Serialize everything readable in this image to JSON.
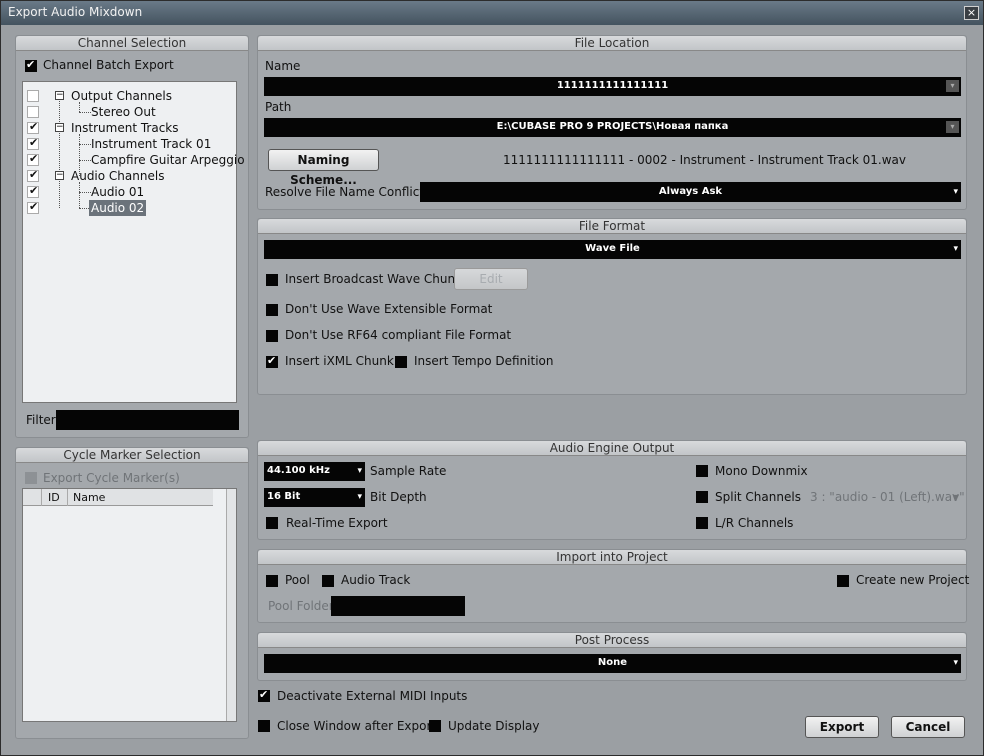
{
  "window": {
    "title": "Export Audio Mixdown",
    "close": "×"
  },
  "channel_selection": {
    "header": "Channel Selection",
    "batch_export": {
      "label": "Channel Batch Export",
      "checked": true
    },
    "tree": [
      {
        "label": "Output Channels",
        "checked": false,
        "level": 0
      },
      {
        "label": "Stereo Out",
        "checked": false,
        "level": 1
      },
      {
        "label": "Instrument Tracks",
        "checked": true,
        "level": 0
      },
      {
        "label": "Instrument Track 01",
        "checked": true,
        "level": 1
      },
      {
        "label": "Campfire Guitar Arpeggio",
        "checked": true,
        "level": 1
      },
      {
        "label": "Audio Channels",
        "checked": true,
        "level": 0
      },
      {
        "label": "Audio 01",
        "checked": true,
        "level": 1
      },
      {
        "label": "Audio 02",
        "checked": true,
        "level": 1,
        "selected": true
      }
    ],
    "filter_label": "Filter",
    "filter_value": ""
  },
  "cycle_marker": {
    "header": "Cycle Marker Selection",
    "export_label": "Export Cycle Marker(s)",
    "columns": [
      "ID",
      "Name"
    ]
  },
  "file_location": {
    "header": "File Location",
    "name_label": "Name",
    "name_value": "1111111111111111",
    "path_label": "Path",
    "path_value": "E:\\CUBASE PRO 9 PROJECTS\\Новая папка",
    "naming_button": "Naming Scheme...",
    "file_preview": "1111111111111111 - 0002 - Instrument - Instrument Track 01.wav",
    "resolve_label": "Resolve File Name Conflicts",
    "resolve_value": "Always Ask"
  },
  "file_format": {
    "header": "File Format",
    "format_value": "Wave File",
    "broadcast_label": "Insert Broadcast Wave Chunk",
    "edit_button": "Edit",
    "wave_ext_label": "Don't Use Wave Extensible Format",
    "rf64_label": "Don't Use RF64 compliant File Format",
    "ixml_label": "Insert iXML Chunk",
    "tempo_label": "Insert Tempo Definition"
  },
  "audio_engine": {
    "header": "Audio Engine Output",
    "sample_rate_value": "44.100 kHz",
    "sample_rate_label": "Sample Rate",
    "bit_depth_value": "16 Bit",
    "bit_depth_label": "Bit Depth",
    "realtime_label": "Real-Time Export",
    "mono_label": "Mono Downmix",
    "split_label": "Split Channels",
    "split_value": "3 : \"audio - 01 (Left).wav\"",
    "lr_label": "L/R Channels"
  },
  "import_project": {
    "header": "Import into Project",
    "pool_label": "Pool",
    "audio_track_label": "Audio Track",
    "new_project_label": "Create new Project",
    "pool_folder_label": "Pool Folder"
  },
  "post_process": {
    "header": "Post Process",
    "value": "None"
  },
  "footer": {
    "deactivate_midi": "Deactivate External MIDI Inputs",
    "close_after": "Close Window after Export",
    "update_display": "Update Display",
    "export_button": "Export",
    "cancel_button": "Cancel"
  },
  "glyphs": {
    "dropdown": "▾",
    "check": "✔",
    "collapse": "−"
  }
}
